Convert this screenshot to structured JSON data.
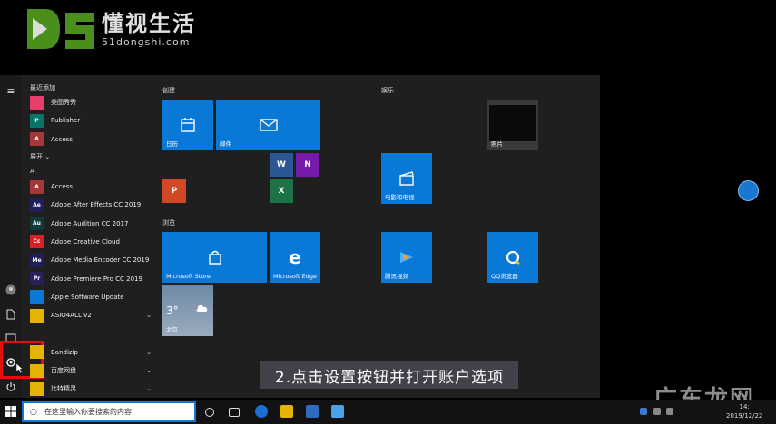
{
  "watermark": {
    "brand_cn": "懂视生活",
    "brand_url": "51dongshi.com",
    "corner_text": "广东龙网"
  },
  "rail": {
    "icons": [
      "menu-icon",
      "user-icon",
      "document-icon",
      "settings-icon",
      "power-icon"
    ]
  },
  "app_list": {
    "recent_header": "最近添加",
    "recent": [
      {
        "label": "美图秀秀",
        "icon_color": "#e83e6c"
      },
      {
        "label": "Publisher",
        "icon_color": "#077568",
        "glyph": "P"
      },
      {
        "label": "Access",
        "icon_color": "#a4373a",
        "glyph": "A"
      }
    ],
    "expand_label": "展开 ⌄",
    "letter_a": "A",
    "apps": [
      {
        "label": "Access",
        "icon_color": "#a4373a",
        "glyph": "A"
      },
      {
        "label": "Adobe After Effects CC 2019",
        "icon_color": "#1f1f5a",
        "glyph": "Ae"
      },
      {
        "label": "Adobe Audition CC 2017",
        "icon_color": "#0f3a3a",
        "glyph": "Au"
      },
      {
        "label": "Adobe Creative Cloud",
        "icon_color": "#da1f26",
        "glyph": "Cc"
      },
      {
        "label": "Adobe Media Encoder CC 2019",
        "icon_color": "#1f1f5a",
        "glyph": "Me"
      },
      {
        "label": "Adobe Premiere Pro CC 2019",
        "icon_color": "#2a1f5a",
        "glyph": "Pr"
      },
      {
        "label": "Apple Software Update",
        "icon_color": "#0a78d7",
        "glyph": ""
      },
      {
        "label": "ASIO4ALL v2",
        "icon_color": "#e6b400",
        "glyph": "",
        "chevron": "⌄"
      },
      {
        "label": "",
        "icon_color": "",
        "glyph": ""
      },
      {
        "label": "Bandizip",
        "icon_color": "#e6b400",
        "glyph": "",
        "chevron": "⌄"
      },
      {
        "label": "百度网盘",
        "icon_color": "#e6b400",
        "glyph": "",
        "chevron": "⌄"
      },
      {
        "label": "比特精灵",
        "icon_color": "#e6b400",
        "glyph": "",
        "chevron": "⌄"
      }
    ]
  },
  "groups": {
    "create": "创建",
    "browse": "浏览",
    "play": "娱乐"
  },
  "tiles": {
    "calendar": "日历",
    "mail": "邮件",
    "store": "Microsoft Store",
    "edge": "Microsoft Edge",
    "weather_temp": "3°",
    "weather_city": "北京",
    "movies": "电影和电视",
    "tencent": "腾讯视频",
    "qq": "QQ浏览器",
    "photo": "照片"
  },
  "caption": "2.点击设置按钮并打开账户选项",
  "blue_dot_text": "",
  "taskbar": {
    "search_placeholder": "在这里输入你要搜索的内容",
    "time": "14:",
    "date": "2019/12/22"
  }
}
